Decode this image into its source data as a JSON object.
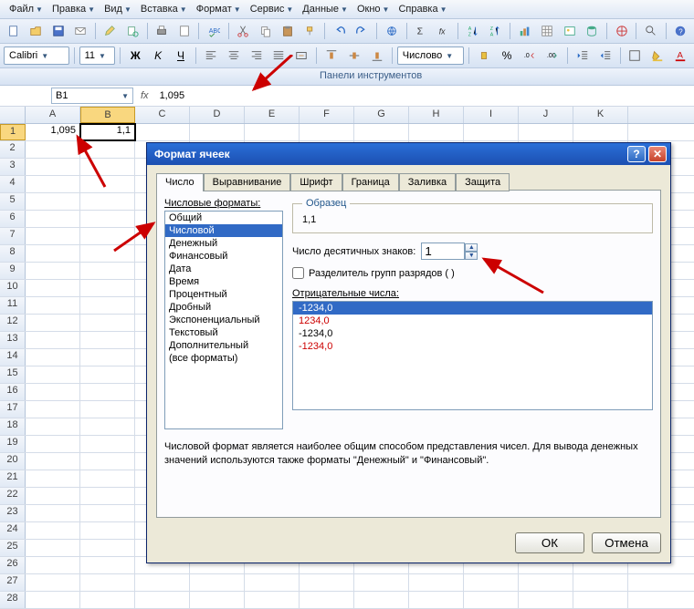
{
  "menu": {
    "items": [
      "Файл",
      "Правка",
      "Вид",
      "Вставка",
      "Формат",
      "Сервис",
      "Данные",
      "Окно",
      "Справка"
    ]
  },
  "font_row": {
    "font_name": "Calibri",
    "font_size": "11",
    "number_format_label": "Числово"
  },
  "panels_label": "Панели инструментов",
  "namebox": "B1",
  "formula": "1,095",
  "fx_symbol": "fx",
  "columns": [
    "A",
    "B",
    "C",
    "D",
    "E",
    "F",
    "G",
    "H",
    "I",
    "J",
    "K"
  ],
  "row_count": 28,
  "cells": {
    "A1": "1,095",
    "B1": "1,1"
  },
  "active_cell": "B1",
  "dialog": {
    "title": "Формат ячеек",
    "tabs": [
      "Число",
      "Выравнивание",
      "Шрифт",
      "Граница",
      "Заливка",
      "Защита"
    ],
    "active_tab": 0,
    "category_label": "Числовые форматы:",
    "categories": [
      "Общий",
      "Числовой",
      "Денежный",
      "Финансовый",
      "Дата",
      "Время",
      "Процентный",
      "Дробный",
      "Экспоненциальный",
      "Текстовый",
      "Дополнительный",
      "(все форматы)"
    ],
    "selected_category": 1,
    "sample_label": "Образец",
    "sample_value": "1,1",
    "decimals_label": "Число десятичных знаков:",
    "decimals_value": "1",
    "sep_label": "Разделитель групп разрядов ( )",
    "neg_label": "Отрицательные числа:",
    "neg_options": [
      {
        "text": "-1234,0",
        "color": "#000"
      },
      {
        "text": "1234,0",
        "color": "#c00"
      },
      {
        "text": "-1234,0",
        "color": "#000"
      },
      {
        "text": "-1234,0",
        "color": "#c00"
      }
    ],
    "selected_neg": 0,
    "hint": "Числовой формат является наиболее общим способом представления чисел. Для вывода денежных значений используются также форматы \"Денежный\" и \"Финансовый\".",
    "ok": "ОК",
    "cancel": "Отмена"
  }
}
